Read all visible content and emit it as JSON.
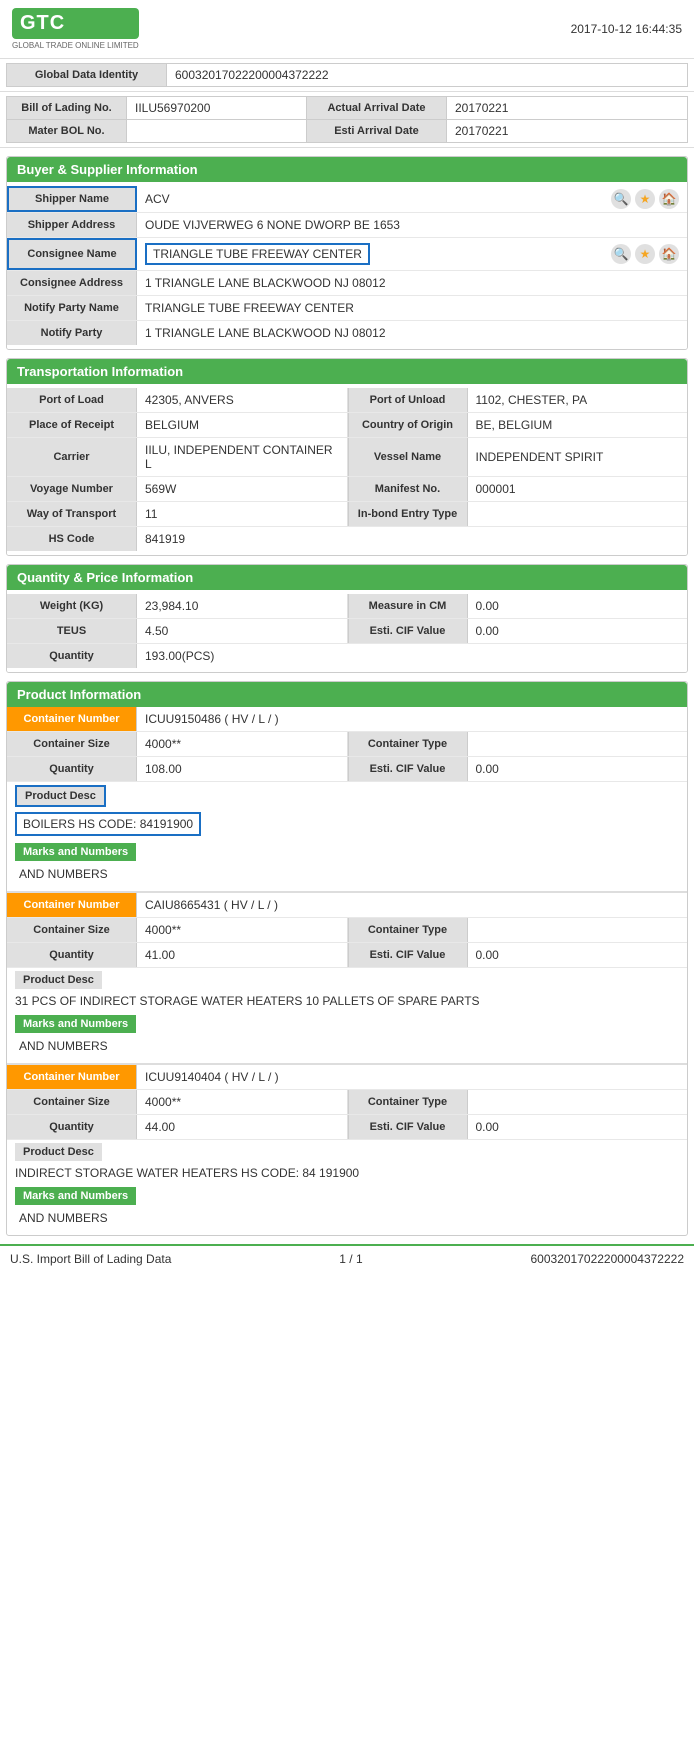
{
  "header": {
    "timestamp": "2017-10-12 16:44:35",
    "logo_text": "GTC",
    "logo_sub": "GLOBAL TRADE ONLINE LIMITED"
  },
  "global_data": {
    "label": "Global Data Identity",
    "value": "60032017022200004372222"
  },
  "bill_info": {
    "bol_label": "Bill of Lading No.",
    "bol_value": "IILU56970200",
    "actual_arrival_label": "Actual Arrival Date",
    "actual_arrival_value": "20170221",
    "master_bol_label": "Mater BOL No.",
    "master_bol_value": "",
    "esti_arrival_label": "Esti Arrival Date",
    "esti_arrival_value": "20170221"
  },
  "buyer_supplier": {
    "section_title": "Buyer & Supplier Information",
    "shipper_name_label": "Shipper Name",
    "shipper_name_value": "ACV",
    "shipper_address_label": "Shipper Address",
    "shipper_address_value": "OUDE VIJVERWEG 6 NONE DWORP BE 1653",
    "consignee_name_label": "Consignee Name",
    "consignee_name_value": "TRIANGLE TUBE FREEWAY CENTER",
    "consignee_address_label": "Consignee Address",
    "consignee_address_value": "1 TRIANGLE LANE BLACKWOOD NJ 08012",
    "notify_party_name_label": "Notify Party Name",
    "notify_party_name_value": "TRIANGLE TUBE FREEWAY CENTER",
    "notify_party_label": "Notify Party",
    "notify_party_value": "1 TRIANGLE LANE BLACKWOOD NJ 08012"
  },
  "transportation": {
    "section_title": "Transportation Information",
    "port_of_load_label": "Port of Load",
    "port_of_load_value": "42305, ANVERS",
    "port_of_unload_label": "Port of Unload",
    "port_of_unload_value": "1102, CHESTER, PA",
    "place_of_receipt_label": "Place of Receipt",
    "place_of_receipt_value": "BELGIUM",
    "country_of_origin_label": "Country of Origin",
    "country_of_origin_value": "BE, BELGIUM",
    "carrier_label": "Carrier",
    "carrier_value": "IILU, INDEPENDENT CONTAINER L",
    "vessel_name_label": "Vessel Name",
    "vessel_name_value": "INDEPENDENT SPIRIT",
    "voyage_number_label": "Voyage Number",
    "voyage_number_value": "569W",
    "manifest_no_label": "Manifest No.",
    "manifest_no_value": "000001",
    "way_of_transport_label": "Way of Transport",
    "way_of_transport_value": "11",
    "in_bond_entry_label": "In-bond Entry Type",
    "in_bond_entry_value": "",
    "hs_code_label": "HS Code",
    "hs_code_value": "841919"
  },
  "quantity_price": {
    "section_title": "Quantity & Price Information",
    "weight_label": "Weight (KG)",
    "weight_value": "23,984.10",
    "measure_label": "Measure in CM",
    "measure_value": "0.00",
    "teus_label": "TEUS",
    "teus_value": "4.50",
    "esti_cif_label": "Esti. CIF Value",
    "esti_cif_value": "0.00",
    "quantity_label": "Quantity",
    "quantity_value": "193.00(PCS)"
  },
  "product_info": {
    "section_title": "Product Information",
    "containers": [
      {
        "container_number_label": "Container Number",
        "container_number_value": "ICUU9150486 ( HV / L / )",
        "container_size_label": "Container Size",
        "container_size_value": "4000**",
        "container_type_label": "Container Type",
        "container_type_value": "",
        "quantity_label": "Quantity",
        "quantity_value": "108.00",
        "esti_cif_label": "Esti. CIF Value",
        "esti_cif_value": "0.00",
        "product_desc_label": "Product Desc",
        "product_desc_value": "BOILERS HS CODE: 84191900",
        "marks_label": "Marks and Numbers",
        "marks_value": "AND NUMBERS"
      },
      {
        "container_number_label": "Container Number",
        "container_number_value": "CAIU8665431 ( HV / L / )",
        "container_size_label": "Container Size",
        "container_size_value": "4000**",
        "container_type_label": "Container Type",
        "container_type_value": "",
        "quantity_label": "Quantity",
        "quantity_value": "41.00",
        "esti_cif_label": "Esti. CIF Value",
        "esti_cif_value": "0.00",
        "product_desc_label": "Product Desc",
        "product_desc_value": "31 PCS OF INDIRECT STORAGE WATER HEATERS 10 PALLETS OF SPARE PARTS",
        "marks_label": "Marks and Numbers",
        "marks_value": "AND NUMBERS"
      },
      {
        "container_number_label": "Container Number",
        "container_number_value": "ICUU9140404 ( HV / L / )",
        "container_size_label": "Container Size",
        "container_size_value": "4000**",
        "container_type_label": "Container Type",
        "container_type_value": "",
        "quantity_label": "Quantity",
        "quantity_value": "44.00",
        "esti_cif_label": "Esti. CIF Value",
        "esti_cif_value": "0.00",
        "product_desc_label": "Product Desc",
        "product_desc_value": "INDIRECT STORAGE WATER HEATERS HS CODE: 84 191900",
        "marks_label": "Marks and Numbers",
        "marks_value": "AND NUMBERS"
      }
    ]
  },
  "footer": {
    "left": "U.S. Import Bill of Lading Data",
    "center": "1 / 1",
    "right": "60032017022200004372222"
  }
}
